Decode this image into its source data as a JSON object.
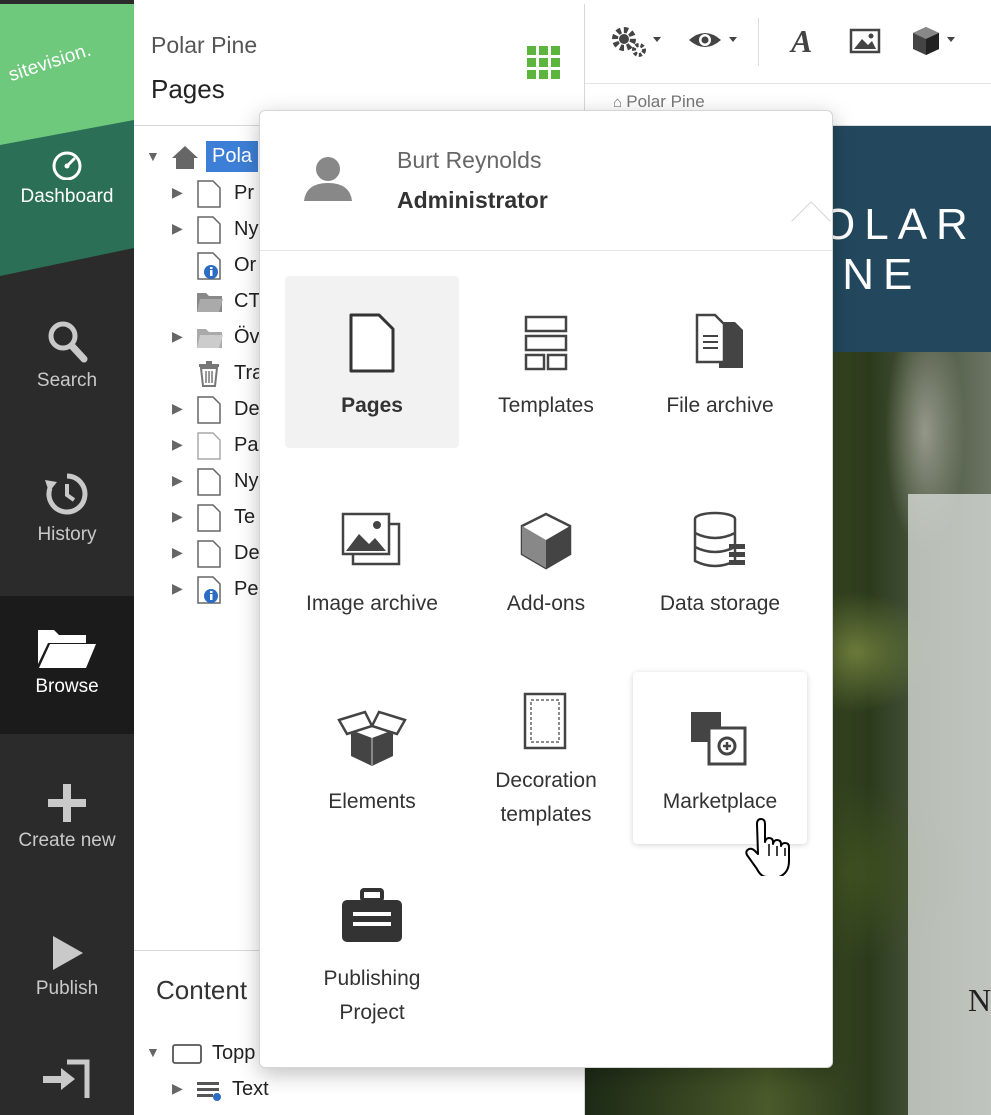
{
  "app": {
    "logo_text": "sitevision."
  },
  "sidebar": {
    "items": [
      {
        "label": "Dashboard",
        "icon": "gauge-icon"
      },
      {
        "label": "Search",
        "icon": "search-icon"
      },
      {
        "label": "History",
        "icon": "history-icon"
      },
      {
        "label": "Browse",
        "icon": "folder-open-icon"
      },
      {
        "label": "Create new",
        "icon": "plus-icon"
      },
      {
        "label": "Publish",
        "icon": "play-icon"
      },
      {
        "label": "",
        "icon": "exit-icon"
      }
    ]
  },
  "panel": {
    "site_name": "Polar Pine",
    "title": "Pages",
    "tree": [
      {
        "label": "Pola",
        "icon": "home-icon"
      },
      {
        "label": "Pr",
        "icon": "page-icon"
      },
      {
        "label": "Ny",
        "icon": "page-icon"
      },
      {
        "label": "Or",
        "icon": "info-page-icon"
      },
      {
        "label": "CT",
        "icon": "folder-icon"
      },
      {
        "label": "Öv",
        "icon": "folder-icon"
      },
      {
        "label": "Tra",
        "icon": "trash-icon"
      },
      {
        "label": "De",
        "icon": "page-icon"
      },
      {
        "label": "Pa",
        "icon": "page-icon"
      },
      {
        "label": "Ny",
        "icon": "page-icon"
      },
      {
        "label": "Te",
        "icon": "page-icon"
      },
      {
        "label": "De",
        "icon": "page-icon"
      },
      {
        "label": "Pe",
        "icon": "info-page-icon"
      }
    ],
    "content_title": "Content",
    "content_tree": [
      {
        "label": "Topp",
        "icon": "box-icon"
      },
      {
        "label": "Text",
        "icon": "text-module-icon"
      }
    ]
  },
  "toolbar": {
    "breadcrumb": "Polar Pine",
    "icons": [
      "gears-icon",
      "eye-icon",
      "font-icon",
      "image-icon",
      "cube-icon"
    ]
  },
  "preview": {
    "hero_line1": "OLAR",
    "hero_line2": "INE",
    "card_letter": "N"
  },
  "popover": {
    "user_name": "Burt Reynolds",
    "user_role": "Administrator",
    "tiles": [
      {
        "label": "Pages",
        "icon": "page-icon",
        "state": "selected"
      },
      {
        "label": "Templates",
        "icon": "templates-icon"
      },
      {
        "label": "File archive",
        "icon": "file-archive-icon"
      },
      {
        "label": "Image archive",
        "icon": "image-archive-icon"
      },
      {
        "label": "Add-ons",
        "icon": "cube-icon"
      },
      {
        "label": "Data storage",
        "icon": "database-icon"
      },
      {
        "label": "Elements",
        "icon": "open-box-icon"
      },
      {
        "label": "Decoration templates",
        "icon": "decoration-template-icon"
      },
      {
        "label": "Marketplace",
        "icon": "marketplace-icon",
        "state": "hover"
      },
      {
        "label": "Publishing Project",
        "icon": "briefcase-icon"
      }
    ]
  },
  "colors": {
    "brand_green": "#6fc97c",
    "dashboard_teal": "#2a6f56",
    "sidebar_dark": "#2b2b2b",
    "grid_green": "#5cb63e",
    "hero_navy": "#23485d",
    "tree_selected": "#3d7fd6"
  }
}
